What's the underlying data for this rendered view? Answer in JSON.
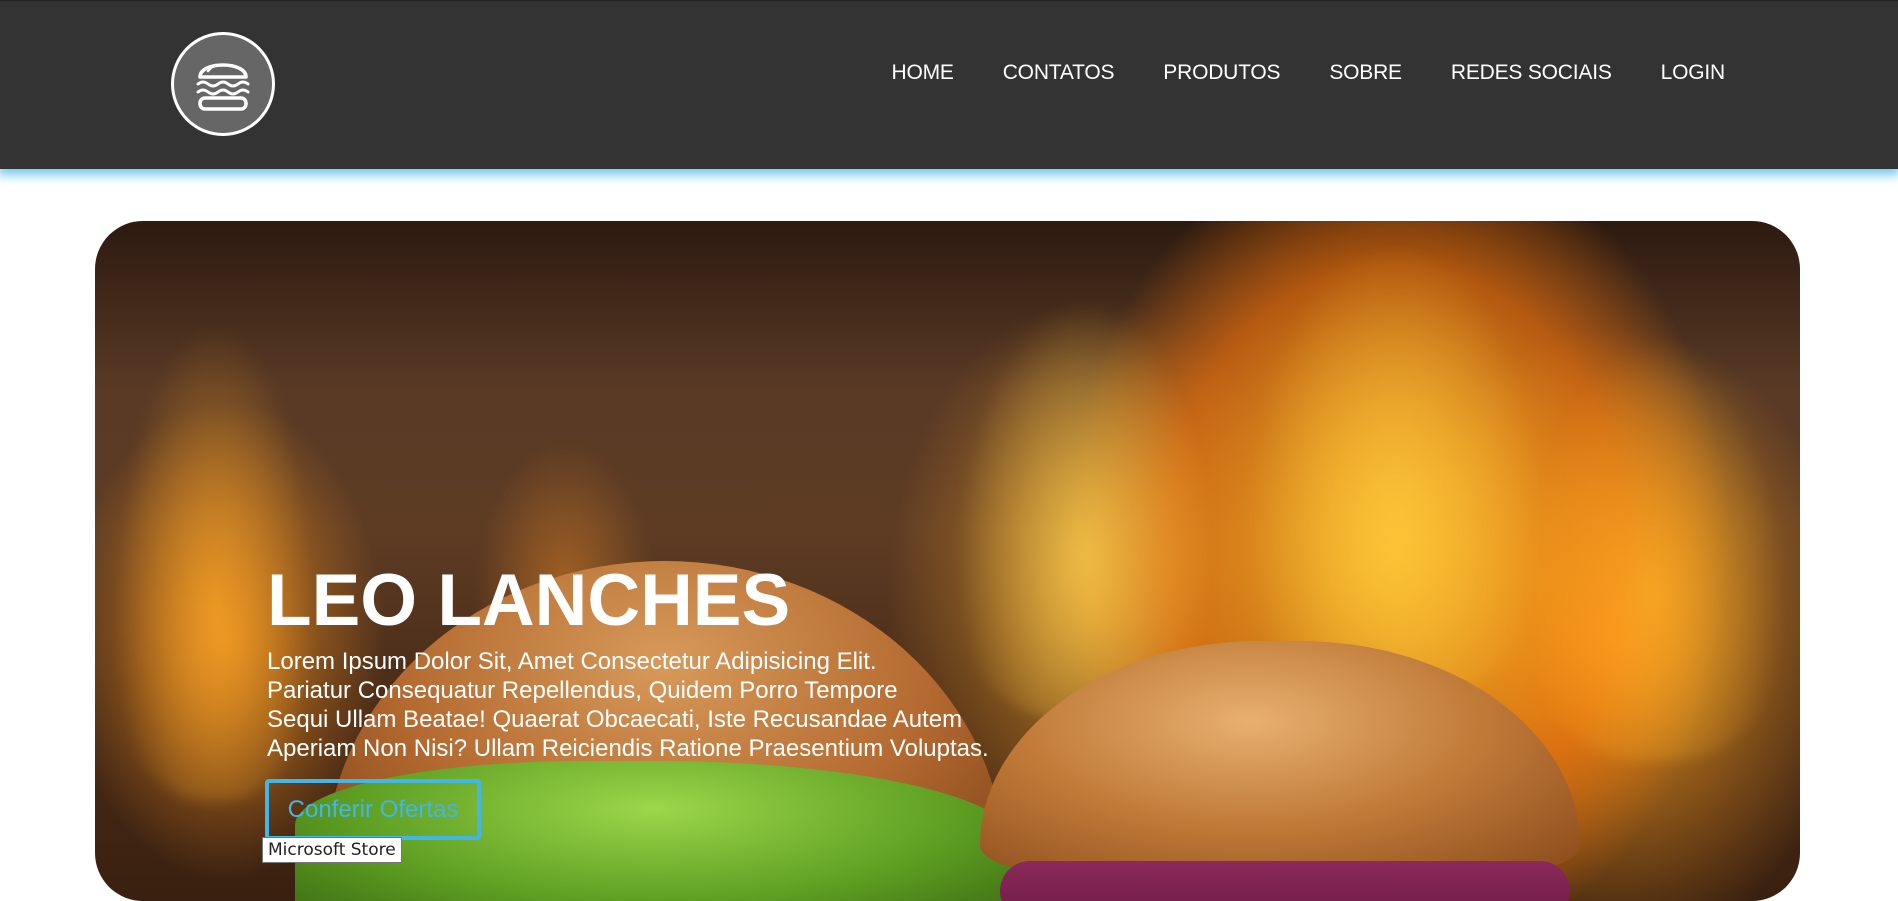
{
  "header": {
    "logo_icon": "burger-icon",
    "background_color": "#333333",
    "accent_glow": "#5abef0"
  },
  "nav": {
    "items": [
      {
        "label": "HOME"
      },
      {
        "label": "CONTATOS"
      },
      {
        "label": "PRODUTOS"
      },
      {
        "label": "SOBRE"
      },
      {
        "label": "REDES SOCIAIS"
      },
      {
        "label": "LOGIN"
      }
    ]
  },
  "hero": {
    "title": "LEO LANCHES",
    "text": "Lorem Ipsum Dolor Sit, Amet Consectetur Adipisicing Elit.\nPariatur Consequatur Repellendus, Quidem Porro Tempore\nSequi Ullam Beatae! Quaerat Obcaecati, Iste Recusandae Autem\nAperiam Non Nisi? Ullam Reiciendis Ratione Praesentium Voluptas.",
    "cta_label": "Conferir Ofertas",
    "cta_color": "#42b6e6",
    "background_image": "burgers-with-flames"
  },
  "tooltip": {
    "text": "Microsoft Store"
  }
}
